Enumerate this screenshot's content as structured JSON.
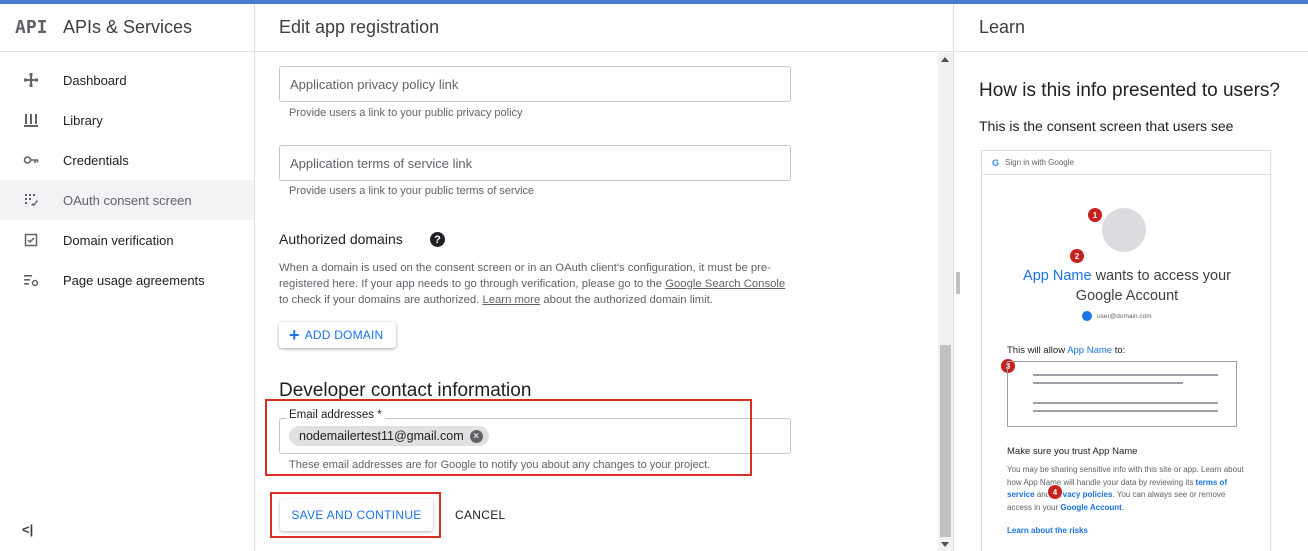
{
  "sidebar": {
    "logo": "API",
    "title": "APIs & Services",
    "items": [
      {
        "label": "Dashboard",
        "icon": "dashboard-icon"
      },
      {
        "label": "Library",
        "icon": "library-icon"
      },
      {
        "label": "Credentials",
        "icon": "key-icon"
      },
      {
        "label": "OAuth consent screen",
        "icon": "consent-icon",
        "active": true
      },
      {
        "label": "Domain verification",
        "icon": "checkbox-icon"
      },
      {
        "label": "Page usage agreements",
        "icon": "settings-list-icon"
      }
    ],
    "collapse_label": "<|"
  },
  "main": {
    "title": "Edit app registration",
    "privacy_placeholder": "Application privacy policy link",
    "privacy_hint": "Provide users a link to your public privacy policy",
    "terms_placeholder": "Application terms of service link",
    "terms_hint": "Provide users a link to your public terms of service",
    "authorized_domains_heading": "Authorized domains",
    "authorized_domains_text_1": "When a domain is used on the consent screen or in an OAuth client's configuration, it must be pre-registered here. If your app needs to go through verification, please go to the ",
    "authorized_domains_link_1": "Google Search Console",
    "authorized_domains_text_2": " to check if your domains are authorized. ",
    "authorized_domains_link_2": "Learn more",
    "authorized_domains_text_3": " about the authorized domain limit.",
    "add_domain_label": "ADD DOMAIN",
    "developer_heading": "Developer contact information",
    "email_label": "Email addresses *",
    "email_chip": "nodemailertest11@gmail.com",
    "email_hint": "These email addresses are for Google to notify you about any changes to your project.",
    "save_label": "SAVE AND CONTINUE",
    "cancel_label": "CANCEL"
  },
  "learn": {
    "title": "Learn",
    "heading": "How is this info presented to users?",
    "subheading": "This is the consent screen that users see",
    "preview": {
      "signin": "Sign in with Google",
      "app_name": "App Name",
      "wants_text": " wants to access your",
      "account_text": "Google Account",
      "user_email": "user@domain.com",
      "allow_prefix": "This will allow ",
      "allow_suffix": " to:",
      "trust": "Make sure you trust App Name",
      "para_1": "You may be sharing sensitive info with this site or app. Learn about how App Name will handle your data by reviewing its ",
      "terms_link": "terms of service",
      "para_and": " and ",
      "privacy_link": "privacy policies",
      "para_2": ". You can always see or remove access in your ",
      "account_link": "Google Account",
      "para_end": ".",
      "risks_link": "Learn about the risks",
      "badges": [
        "1",
        "2",
        "3",
        "4"
      ]
    }
  },
  "colors": {
    "accent": "#1a73e8",
    "highlight_box": "#d93025",
    "top_bar": "#4a7bd0"
  }
}
